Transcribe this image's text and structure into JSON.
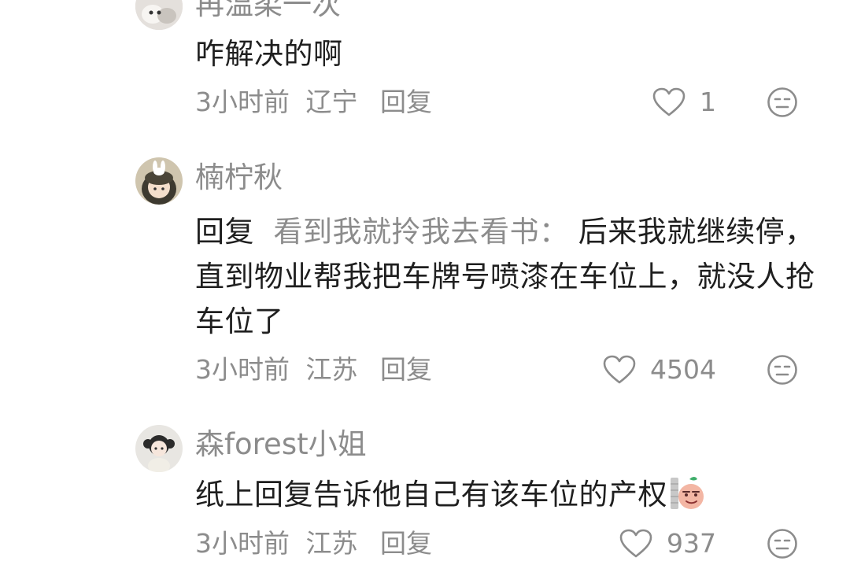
{
  "comments": [
    {
      "username": "再温柔一次",
      "text": "咋解决的啊",
      "time": "3小时前",
      "location": "辽宁",
      "reply_label": "回复",
      "likes": "1"
    },
    {
      "username": "楠柠秋",
      "reply_prefix": "回复",
      "reply_target": "看到我就拎我去看书：",
      "text": "后来我就继续停，直到物业帮我把车牌号喷漆在车位上，就没人抢车位了",
      "time": "3小时前",
      "location": "江苏",
      "reply_label": "回复",
      "likes": "4504"
    },
    {
      "username": "森forest小姐",
      "text": "纸上回复告诉他自己有该车位的产权",
      "time": "3小时前",
      "location": "江苏",
      "reply_label": "回复",
      "likes": "937"
    }
  ],
  "icons": {
    "like": "heart-outline-icon",
    "dislike": "neutral-face-icon",
    "sticker": "peeking-emoji-sticker"
  },
  "colors": {
    "primary_text": "#1f1f1f",
    "secondary_text": "#8c8c8c",
    "background": "#ffffff"
  }
}
